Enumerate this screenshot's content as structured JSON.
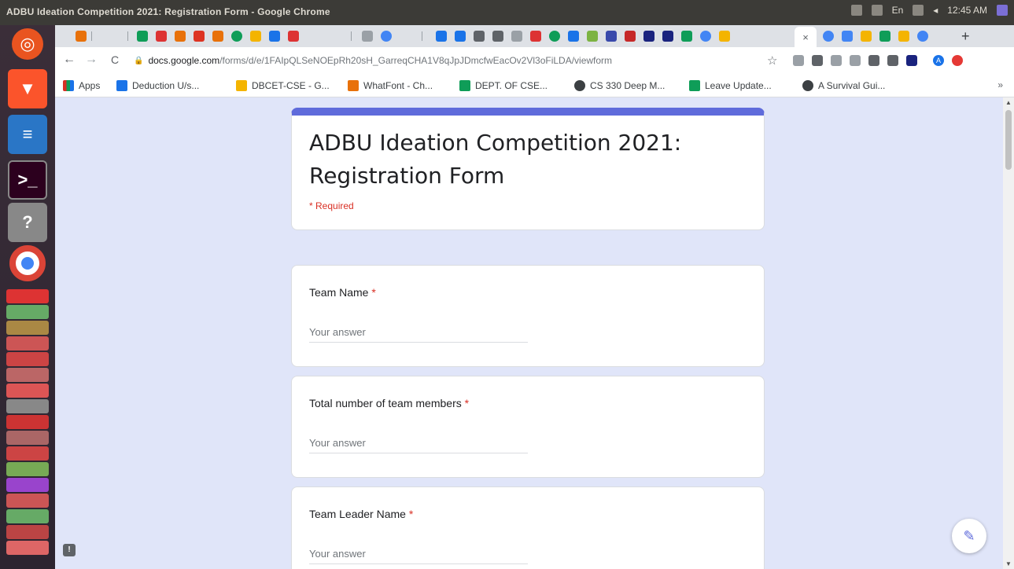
{
  "window": {
    "title": "ADBU Ideation Competition 2021: Registration Form - Google Chrome",
    "clock": "12:45 AM",
    "kb_layout": "En"
  },
  "launcher": {
    "items": [
      "ubuntu-logo-icon",
      "brave-icon",
      "writer-icon",
      "terminal-icon",
      "help-icon",
      "chrome-icon"
    ]
  },
  "toolbar": {
    "back_icon": "←",
    "forward_icon": "→",
    "reload_icon": "C",
    "url_domain": "docs.google.com",
    "url_path": "/forms/d/e/1FAIpQLSeNOEpRh20sH_GarreqCHA1V8qJpJDmcfwEacOv2Vl3oFiLDA/viewform",
    "star_icon": "☆",
    "profile_letter": "A"
  },
  "tabs": {
    "close_icon": "×",
    "new_tab": "+"
  },
  "bookmarks": {
    "apps": "Apps",
    "items": [
      {
        "label": "Deduction U/s...",
        "color": "#1a73e8"
      },
      {
        "label": "DBCET-CSE - G...",
        "color": "#f4b400"
      },
      {
        "label": "WhatFont - Ch...",
        "color": "#e8710a"
      },
      {
        "label": "DEPT. OF CSE...",
        "color": "#0f9d58"
      },
      {
        "label": "CS 330 Deep M...",
        "color": "#3c4043"
      },
      {
        "label": "Leave Update...",
        "color": "#0f9d58"
      },
      {
        "label": "A Survival Gui...",
        "color": "#3c4043"
      }
    ],
    "more": "»"
  },
  "form": {
    "title": "ADBU Ideation Competition 2021: Registration Form",
    "required_note": "* Required",
    "questions": [
      {
        "label": "Team Name",
        "placeholder": "Your answer"
      },
      {
        "label": "Total number of team members",
        "placeholder": "Your answer"
      },
      {
        "label": "Team Leader Name",
        "placeholder": "Your answer"
      }
    ],
    "required_mark": "*"
  },
  "colors": {
    "accent": "#5f6bdb",
    "page_bg": "#e0e5f9",
    "required": "#d93025"
  }
}
